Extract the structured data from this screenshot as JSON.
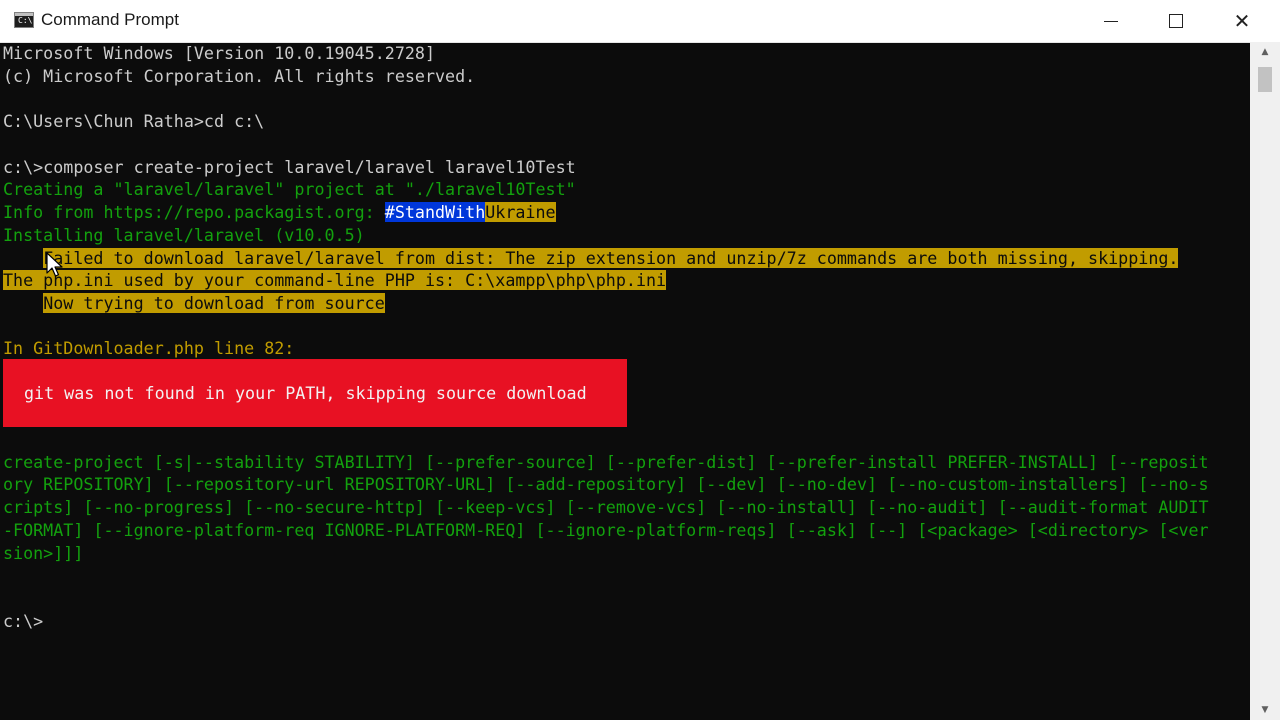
{
  "window": {
    "title": "Command Prompt",
    "app_icon_text": "C:\\",
    "buttons": {
      "minimize": "minimize-icon",
      "maximize": "maximize-icon",
      "close": "close-icon"
    },
    "close_glyph": "✕"
  },
  "console": {
    "header1": "Microsoft Windows [Version 10.0.19045.2728]",
    "header2": "(c) Microsoft Corporation. All rights reserved.",
    "cmd1": "C:\\Users\\Chun Ratha>cd c:\\",
    "cmd2": "c:\\>composer create-project laravel/laravel laravel10Test",
    "creating": "Creating a \"laravel/laravel\" project at \"./laravel10Test\"",
    "info_prefix": "Info from https://repo.packagist.org: ",
    "info_selected": "#StandWith",
    "info_rest": "Ukraine",
    "installing": "Installing laravel/laravel (v10.0.5)",
    "warn1": "Failed to download laravel/laravel from dist: The zip extension and unzip/7z commands are both missing, skipping.",
    "warn2": "The php.ini used by your command-line PHP is: C:\\xampp\\php\\php.ini",
    "warn3": "Now trying to download from source",
    "in_file": "In GitDownloader.php line 82:",
    "error_message": "git was not found in your PATH, skipping source download",
    "usage": [
      "create-project [-s|--stability STABILITY] [--prefer-source] [--prefer-dist] [--prefer-install PREFER-INSTALL] [--reposit",
      "ory REPOSITORY] [--repository-url REPOSITORY-URL] [--add-repository] [--dev] [--no-dev] [--no-custom-installers] [--no-s",
      "cripts] [--no-progress] [--no-secure-http] [--keep-vcs] [--remove-vcs] [--no-install] [--no-audit] [--audit-format AUDIT",
      "-FORMAT] [--ignore-platform-req IGNORE-PLATFORM-REQ] [--ignore-platform-reqs] [--ask] [--] [<package> [<directory> [<ver",
      "sion>]]]"
    ],
    "prompt": "c:\\>"
  },
  "scrollbar": {
    "up": "▲",
    "down": "▼"
  },
  "colors": {
    "background": "#0c0c0c",
    "default_text": "#cccccc",
    "green": "#13a10e",
    "orange": "#c19c00",
    "error_bg": "#e81123",
    "selection": "#0037da"
  }
}
